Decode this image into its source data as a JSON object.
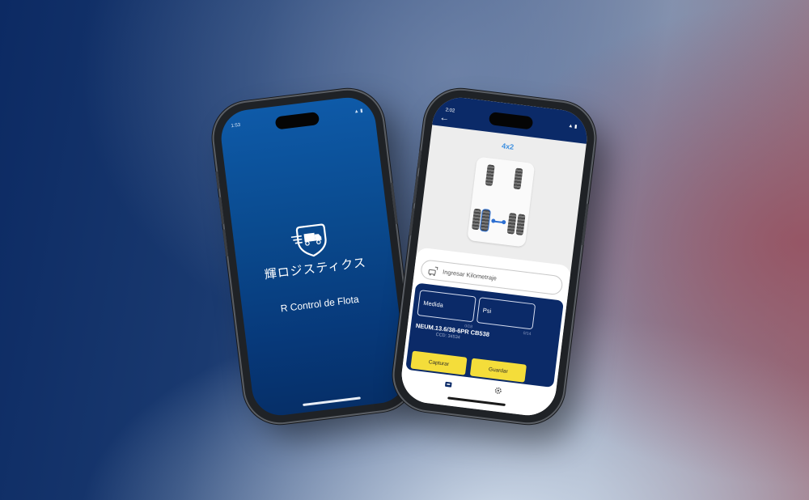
{
  "splash": {
    "status_time": "1:53",
    "logo_text": "輝ロジスティクス",
    "app_name": "R Control de Flota"
  },
  "tire_screen": {
    "status_time": "2:02",
    "back_icon": "arrow-left-icon",
    "axle_config": "4x2",
    "km_placeholder": "Ingresar Kilometraje",
    "measure_label": "Medida",
    "measure_hint": "0/18",
    "psi_label": "Psi",
    "psi_hint": "0/14",
    "tire_name": "NEUM.13.6/38-6PR CB538",
    "tire_code": "CCD: 34534",
    "capture_label": "Capturar",
    "save_label": "Guardar",
    "nav": [
      "truck-icon",
      "gear-icon"
    ],
    "colors": {
      "header": "#0b2a68",
      "accent": "#3d8fe0",
      "button": "#f4dd3a"
    }
  }
}
